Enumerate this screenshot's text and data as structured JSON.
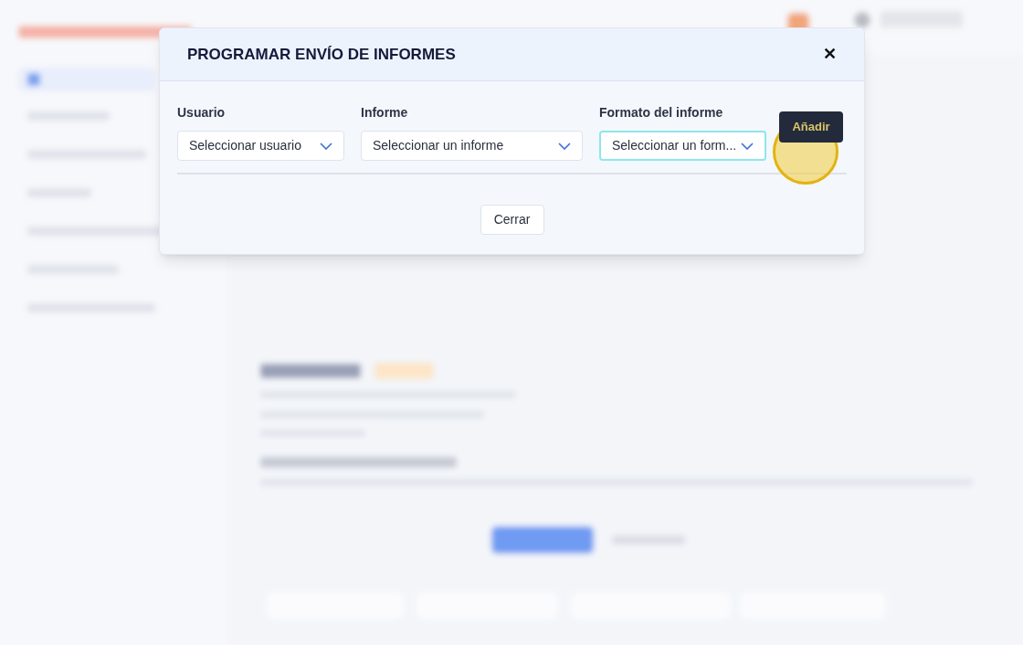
{
  "dialog": {
    "title": "PROGRAMAR ENVÍO DE INFORMES",
    "close_icon": "✕",
    "fields": [
      {
        "label": "Usuario",
        "value": "Seleccionar usuario",
        "focused": false
      },
      {
        "label": "Informe",
        "value": "Seleccionar un informe",
        "focused": false
      },
      {
        "label": "Formato del informe",
        "value": "Seleccionar un form...",
        "focused": true
      }
    ],
    "add_button": "Añadir",
    "close_button": "Cerrar"
  }
}
